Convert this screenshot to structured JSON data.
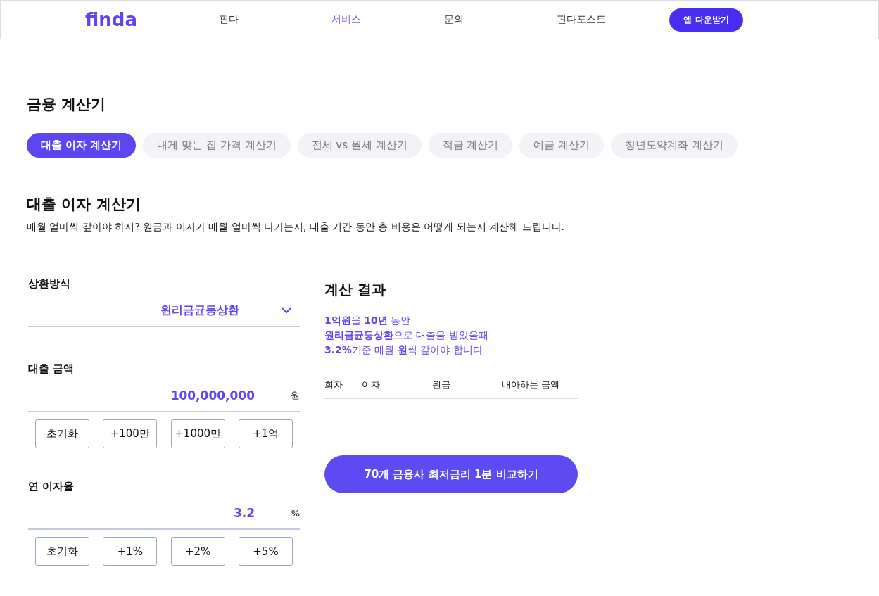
{
  "header": {
    "logo": "finda",
    "nav": [
      {
        "label": "핀다",
        "selected": false
      },
      {
        "label": "서비스",
        "selected": true
      },
      {
        "label": "문의",
        "selected": false
      },
      {
        "label": "핀다포스트",
        "selected": false
      }
    ],
    "cta": "앱 다운받기"
  },
  "page_title": "금융 계산기",
  "tabs": [
    {
      "label": "대출 이자 계산기",
      "selected": true
    },
    {
      "label": "내게 맞는 집 가격 계산기",
      "selected": false
    },
    {
      "label": "전세 vs 월세 계산기",
      "selected": false
    },
    {
      "label": "적금 계산기",
      "selected": false
    },
    {
      "label": "예금 계산기",
      "selected": false
    },
    {
      "label": "청년도약계좌 계산기",
      "selected": false
    }
  ],
  "section": {
    "title": "대출 이자 계산기",
    "description": "매월 얼마씩 갚아야 하지?  원금과 이자가 매월 얼마씩 나가는지, 대출 기간 동안 총 비용은 어떻게 되는지 계산해 드립니다."
  },
  "form": {
    "repayment": {
      "label": "상환방식",
      "value": "원리금균등상환"
    },
    "fields": [
      {
        "label": "대출 금액",
        "value": "100,000,000",
        "unit": "원",
        "buttons": [
          "초기화",
          "+100만",
          "+1000만",
          "+1억"
        ]
      },
      {
        "label": "연 이자율",
        "value": "3.2",
        "unit": "%",
        "buttons": [
          "초기화",
          "+1%",
          "+2%",
          "+5%"
        ]
      }
    ]
  },
  "result": {
    "title": "계산 결과",
    "lines": [
      "**1억원**을 **10년**  동안",
      "**원리금균등상환**으로 대출을 받았을때",
      "**3.2%**기준 매월 **원**씩 갚아야 합니다"
    ],
    "columns": [
      "회차",
      "이자",
      "원금",
      "내아하는 금액"
    ],
    "button": "70개 금융사 최저금리 1분 비교하기"
  }
}
